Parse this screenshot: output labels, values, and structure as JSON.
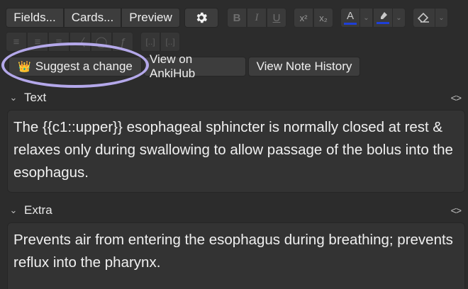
{
  "toolbar": {
    "fields_label": "Fields...",
    "cards_label": "Cards...",
    "preview_label": "Preview",
    "settings_icon": "gear-icon",
    "bold_label": "B",
    "italic_label": "I",
    "underline_label": "U",
    "superscript_label": "x²",
    "subscript_label": "x₂",
    "text_color_label": "A",
    "text_color": "#1e3fd8",
    "highlight_color": "#1e3fd8"
  },
  "ankihub": {
    "suggest_icon": "👑",
    "suggest_label": "Suggest a change",
    "view_label": "View on AnkiHub",
    "history_label": "View Note History"
  },
  "fields": [
    {
      "name": "Text",
      "content": "The {{c1::upper}} esophageal sphincter is normally closed at rest & relaxes only during swallowing to allow passage of the bolus into the esophagus."
    },
    {
      "name": "Extra",
      "content": "Prevents air from entering the esophagus during breathing; prevents reflux into the pharynx."
    }
  ],
  "annotation": {
    "color": "#b4a8ea"
  }
}
